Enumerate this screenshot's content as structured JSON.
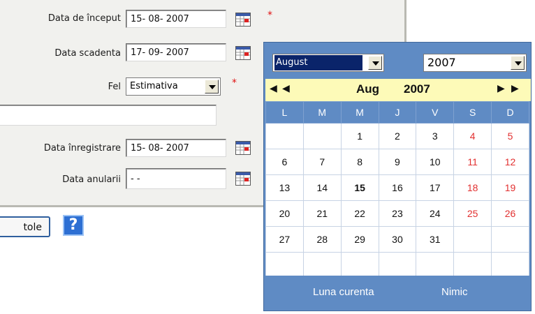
{
  "form": {
    "start_date_label": "Data de început",
    "start_date_value": "15- 08-  2007",
    "due_date_label": "Data scadenta",
    "due_date_value": "17- 09-  2007",
    "type_label": "Fel",
    "type_value": "Estimativa",
    "registration_date_label": "Data înregistrare",
    "registration_date_value": "15- 08-  2007",
    "cancel_date_label": "Data anularii",
    "cancel_date_value": "   -    -",
    "required_marker": "*",
    "titles_button_label": "tole",
    "help_button_label": "?"
  },
  "calendar": {
    "month_select_value": "August",
    "year_select_value": "2007",
    "prev_year_symbol": "◀",
    "prev_month_symbol": "◀",
    "next_month_symbol": "▶",
    "next_year_symbol": "▶",
    "nav_month": "Aug",
    "nav_year": "2007",
    "weekdays": [
      "L",
      "M",
      "M",
      "J",
      "V",
      "S",
      "D"
    ],
    "weeks": [
      [
        "",
        "",
        "1",
        "2",
        "3",
        "4",
        "5"
      ],
      [
        "6",
        "7",
        "8",
        "9",
        "10",
        "11",
        "12"
      ],
      [
        "13",
        "14",
        "15",
        "16",
        "17",
        "18",
        "19"
      ],
      [
        "20",
        "21",
        "22",
        "23",
        "24",
        "25",
        "26"
      ],
      [
        "27",
        "28",
        "29",
        "30",
        "31",
        "",
        ""
      ],
      [
        "",
        "",
        "",
        "",
        "",
        "",
        ""
      ]
    ],
    "today": "15",
    "footer_current_month": "Luna curenta",
    "footer_none": "Nimic"
  },
  "colors": {
    "calendar_blue": "#5f8bc4",
    "nav_yellow": "#fdfab8",
    "weekend_red": "#e23030"
  }
}
